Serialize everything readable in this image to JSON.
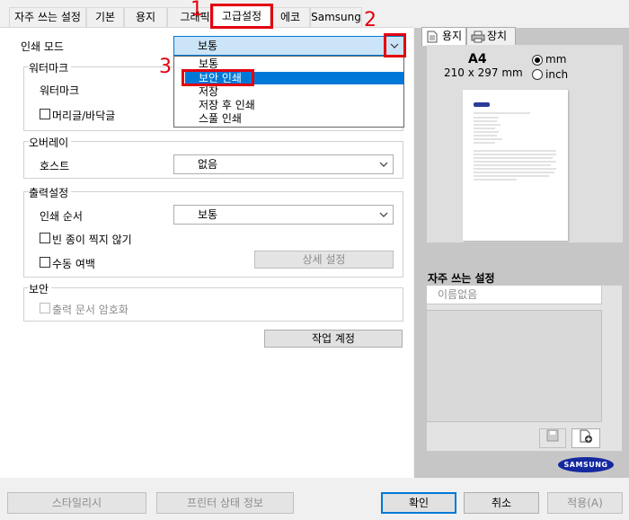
{
  "tabs": {
    "favorites": "자주 쓰는 설정",
    "basic": "기본",
    "paper": "용지",
    "graphics": "그래픽",
    "advanced": "고급설정",
    "eco": "에코",
    "samsung": "Samsung"
  },
  "print_mode": {
    "label": "인쇄 모드",
    "value": "보통",
    "options": [
      "보통",
      "보안 인쇄",
      "저장",
      "저장 후 인쇄",
      "스풀 인쇄"
    ],
    "selected_option": "보안 인쇄"
  },
  "watermark": {
    "group_title": "워터마크",
    "label": "워터마크",
    "header_footer": "머리글/바닥글"
  },
  "overlay": {
    "group_title": "오버레이",
    "host_label": "호스트",
    "host_value": "없음"
  },
  "output": {
    "group_title": "출력설정",
    "order_label": "인쇄 순서",
    "order_value": "보통",
    "skip_blank": "빈 종이 찍지 않기",
    "manual_margin": "수동 여백",
    "detail_button": "상세 설정"
  },
  "security": {
    "group_title": "보안",
    "encrypt": "출력 문서 암호화"
  },
  "job_account_button": "작업 계정",
  "right_panel": {
    "tab_paper": "용지",
    "tab_device": "장치",
    "paper_size": "A4",
    "paper_dims": "210 x 297 mm",
    "unit_mm": "mm",
    "unit_inch": "inch",
    "fav_title": "자주 쓰는 설정",
    "fav_placeholder": "이름없음",
    "brand": "SAMSUNG"
  },
  "footer": {
    "styles": "스타일리시",
    "printer_status": "프린터 상태 정보",
    "ok": "확인",
    "cancel": "취소",
    "apply": "적용(A)"
  },
  "callouts": [
    "1",
    "2",
    "3"
  ],
  "colors": {
    "accent": "#0078d7",
    "callout": "#e3000f",
    "brand_blue": "#1428a0"
  }
}
